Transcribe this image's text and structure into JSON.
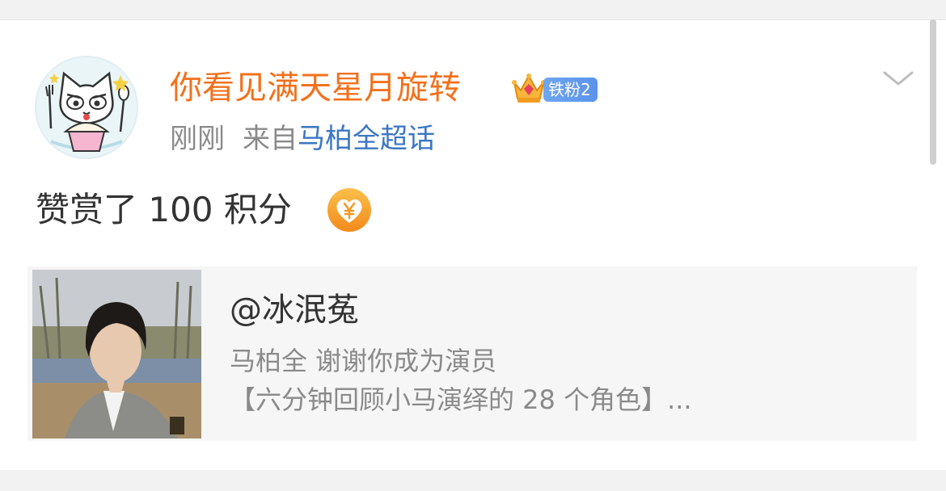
{
  "post": {
    "username": "你看见满天星月旋转",
    "fan_badge": "铁粉2",
    "time": "刚刚",
    "source_prefix": "来自",
    "source_link": "马柏全超话",
    "text": "赞赏了 100 积分",
    "reward_icon": "yen-heart-icon",
    "menu_icon": "chevron-down-icon"
  },
  "card": {
    "title": "@冰泯菟",
    "subtitle": "马柏全 谢谢你成为演员",
    "description": "【六分钟回顾小马演绎的 28 个角色】..."
  },
  "colors": {
    "username": "#f2711c",
    "link": "#3b76c4",
    "badge": "#5a93ea",
    "reward": "#f7a021",
    "muted": "#8a8a8a"
  }
}
